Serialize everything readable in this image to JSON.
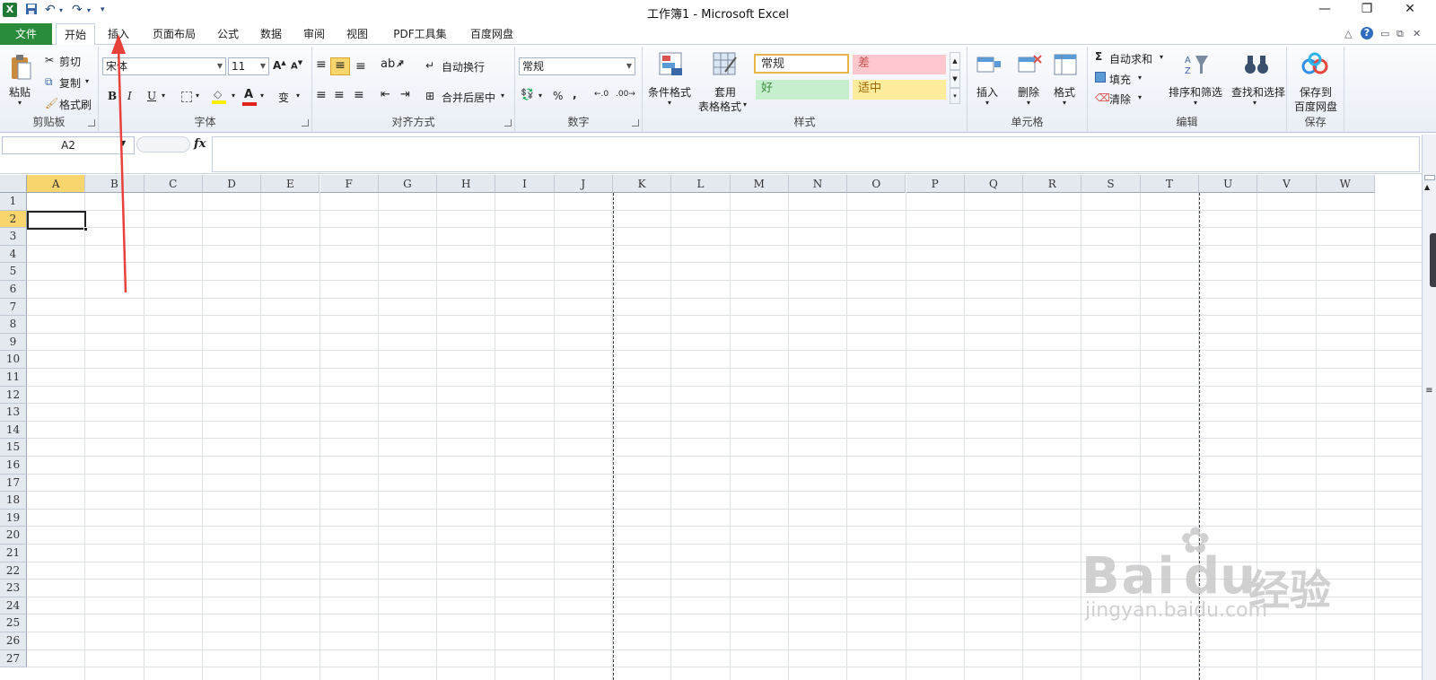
{
  "window": {
    "title": "工作簿1 - Microsoft Excel",
    "controls": {
      "minimize": "—",
      "restore": "❐",
      "close": "✕"
    }
  },
  "quick_access": {
    "customize": "▾"
  },
  "menu": {
    "file": "文件",
    "tabs": [
      "开始",
      "插入",
      "页面布局",
      "公式",
      "数据",
      "审阅",
      "视图",
      "PDF工具集",
      "百度网盘"
    ],
    "active_tab": "开始"
  },
  "ribbon": {
    "clipboard": {
      "paste": "粘贴",
      "cut": "剪切",
      "copy": "复制",
      "format_painter": "格式刷",
      "label": "剪贴板"
    },
    "font": {
      "name": "宋体",
      "size": "11",
      "bold": "B",
      "italic": "I",
      "underline": "U",
      "label": "字体",
      "font_color": "#e2231a",
      "fill_color": "#ffee00"
    },
    "alignment": {
      "wrap": "自动换行",
      "merge": "合并后居中",
      "label": "对齐方式"
    },
    "number": {
      "format": "常规",
      "percent": "%",
      "comma": ",",
      "label": "数字"
    },
    "styles": {
      "conditional": "条件格式",
      "table_format_1": "套用",
      "table_format_2": "表格格式",
      "cells": [
        {
          "text": "常规",
          "bg": "#ffffff",
          "color": "#333333"
        },
        {
          "text": "差",
          "bg": "#ffc7ce",
          "color": "#c0504d"
        },
        {
          "text": "好",
          "bg": "#c6efce",
          "color": "#3e8a3e"
        },
        {
          "text": "适中",
          "bg": "#ffeb9c",
          "color": "#9c6500"
        }
      ],
      "label": "样式"
    },
    "cells_group": {
      "insert": "插入",
      "delete": "删除",
      "format": "格式",
      "label": "单元格"
    },
    "editing": {
      "autosum": "自动求和",
      "fill": "填充",
      "clear": "清除",
      "sort": "排序和筛选",
      "find": "查找和选择",
      "label": "编辑"
    },
    "save": {
      "line1": "保存到",
      "line2": "百度网盘",
      "label": "保存"
    }
  },
  "formula_bar": {
    "name_box": "A2",
    "fx": "fx",
    "content": ""
  },
  "sheet": {
    "columns": [
      "A",
      "B",
      "C",
      "D",
      "E",
      "F",
      "G",
      "H",
      "I",
      "J",
      "K",
      "L",
      "M",
      "N",
      "O",
      "P",
      "Q",
      "R",
      "S",
      "T",
      "U",
      "V",
      "W"
    ],
    "rows": [
      "1",
      "2",
      "3",
      "4",
      "5",
      "6",
      "7",
      "8",
      "9",
      "10",
      "11",
      "12",
      "13",
      "14",
      "15",
      "16",
      "17",
      "18",
      "19",
      "20",
      "21",
      "22",
      "23",
      "24",
      "25",
      "26",
      "27"
    ],
    "selected_cell": "A2",
    "selected_column": "A",
    "selected_row": "2"
  },
  "watermark": {
    "logo_text": "Bai",
    "logo_text2": "du",
    "cn": "经验",
    "url": "jingyan.baidu.com"
  }
}
